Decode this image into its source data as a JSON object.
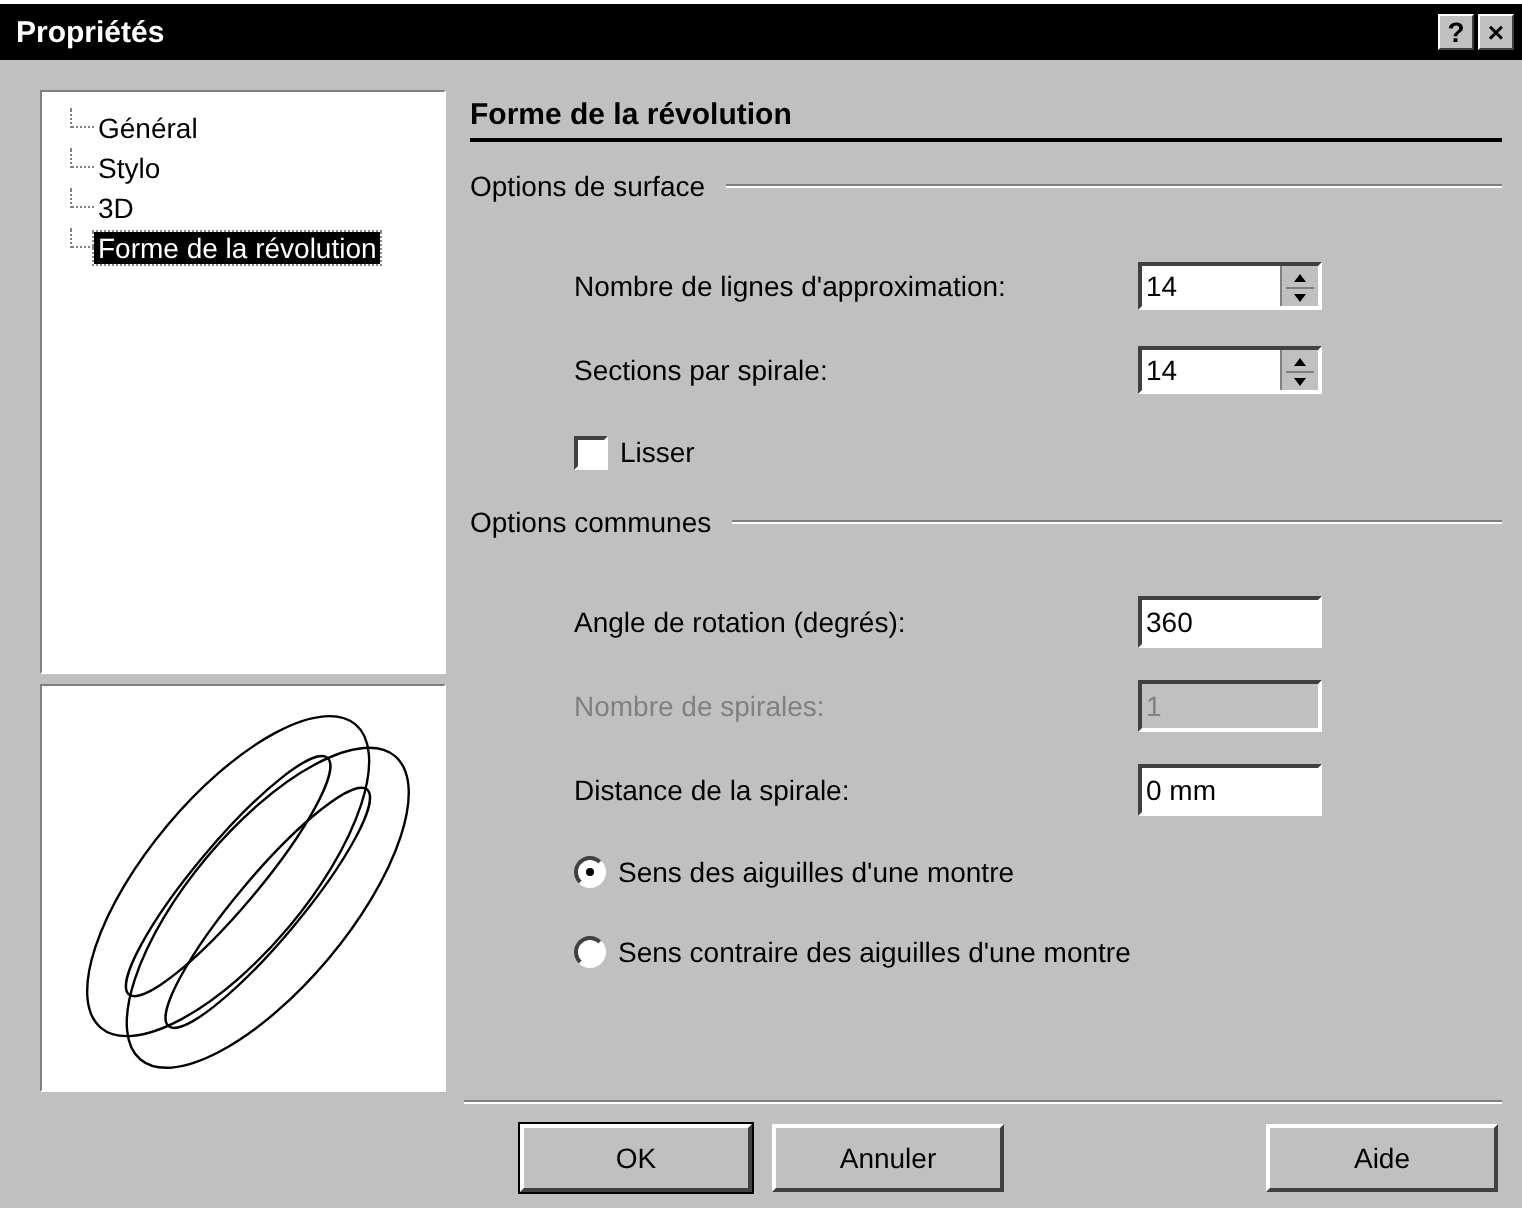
{
  "window": {
    "title": "Propriétés",
    "controls": [
      "?",
      "×"
    ]
  },
  "tree": {
    "items": [
      {
        "label": "Général",
        "selected": false
      },
      {
        "label": "Stylo",
        "selected": false
      },
      {
        "label": "3D",
        "selected": false
      },
      {
        "label": "Forme de la révolution",
        "selected": true
      }
    ]
  },
  "page": {
    "title": "Forme de la révolution",
    "groups": [
      {
        "title": "Options de surface",
        "rows": [
          {
            "kind": "spin",
            "label": "Nombre de lignes d'approximation:",
            "value": "14",
            "disabled": false
          },
          {
            "kind": "spin",
            "label": "Sections par spirale:",
            "value": "14",
            "disabled": false
          },
          {
            "kind": "checkbox",
            "label": "Lisser",
            "checked": false
          }
        ]
      },
      {
        "title": "Options communes",
        "rows": [
          {
            "kind": "text",
            "label": "Angle de rotation (degrés):",
            "value": "360",
            "disabled": false
          },
          {
            "kind": "text",
            "label": "Nombre de spirales:",
            "value": "1",
            "disabled": true
          },
          {
            "kind": "text",
            "label": "Distance de la spirale:",
            "value": "0 mm",
            "disabled": false
          },
          {
            "kind": "radio",
            "label": "Sens des aiguilles d'une montre",
            "selected": true
          },
          {
            "kind": "radio",
            "label": "Sens contraire des aiguilles d'une montre",
            "selected": false
          }
        ]
      }
    ]
  },
  "buttons": [
    {
      "label": "OK",
      "default": true
    },
    {
      "label": "Annuler",
      "default": false
    },
    {
      "label": "Aide",
      "default": false
    }
  ]
}
